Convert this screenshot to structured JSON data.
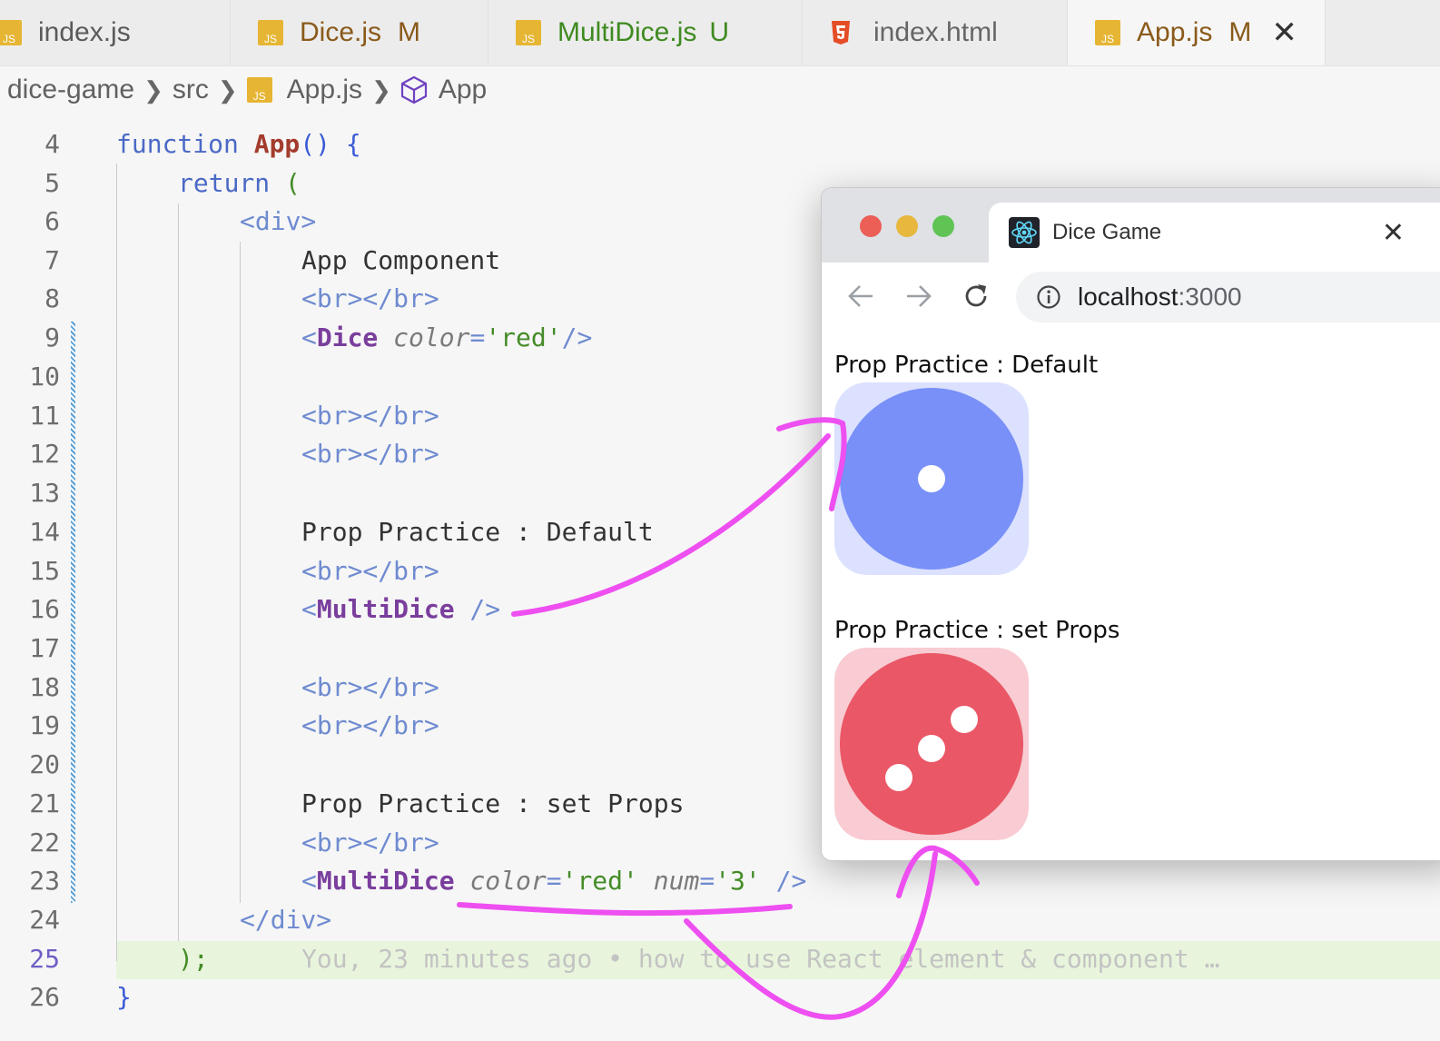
{
  "tabs": [
    {
      "label": "index.js",
      "status": ""
    },
    {
      "label": "Dice.js",
      "status": "M"
    },
    {
      "label": "MultiDice.js",
      "status": "U"
    },
    {
      "label": "index.html",
      "status": ""
    },
    {
      "label": "App.js",
      "status": "M",
      "active": true
    }
  ],
  "tab_icons": {
    "js": "JS",
    "html": "html5-icon"
  },
  "breadcrumb": [
    "dice-game",
    "src",
    "App.js",
    "App"
  ],
  "code": {
    "lines": [
      {
        "n": "4"
      },
      {
        "n": "5"
      },
      {
        "n": "6"
      },
      {
        "n": "7"
      },
      {
        "n": "8"
      },
      {
        "n": "9"
      },
      {
        "n": "10"
      },
      {
        "n": "11"
      },
      {
        "n": "12"
      },
      {
        "n": "13"
      },
      {
        "n": "14"
      },
      {
        "n": "15"
      },
      {
        "n": "16"
      },
      {
        "n": "17"
      },
      {
        "n": "18"
      },
      {
        "n": "19"
      },
      {
        "n": "20"
      },
      {
        "n": "21"
      },
      {
        "n": "22"
      },
      {
        "n": "23"
      },
      {
        "n": "24"
      },
      {
        "n": "25"
      },
      {
        "n": "26"
      }
    ],
    "current_line": "25",
    "t": {
      "function_kw": "function",
      "app_name": "App",
      "paren_open_brace": "() {",
      "return_kw": "return",
      "open_paren": "(",
      "div_open": "<div>",
      "app_component": "App Component",
      "br_tag": "<br></br>",
      "lt": "<",
      "dice_comp": "Dice",
      "color_attr": "color",
      "eq": "=",
      "red_str": "'red'",
      "self_close": "/>",
      "prop_default": "Prop Practice : Default",
      "multidice_comp": "MultiDice",
      "self_close_sp": " />",
      "prop_set": "Prop Practice : set Props",
      "num_attr": "num",
      "num_str": "'3'",
      "div_close": "</div>",
      "close_paren": ");",
      "blame": "You, 23 minutes ago • how to use React element & component …",
      "close_brace": "}"
    }
  },
  "browser": {
    "tab_title": "Dice Game",
    "url_host": "localhost",
    "url_port": ":3000",
    "sections": [
      {
        "label": "Prop Practice : Default",
        "color": "#7890f7",
        "bg": "#dbe1ff",
        "pips": 1
      },
      {
        "label": "Prop Practice : set Props",
        "color": "#ea5767",
        "bg": "#f8ccd2",
        "pips": 3
      }
    ]
  },
  "annotation_color": "#ee4ff0"
}
